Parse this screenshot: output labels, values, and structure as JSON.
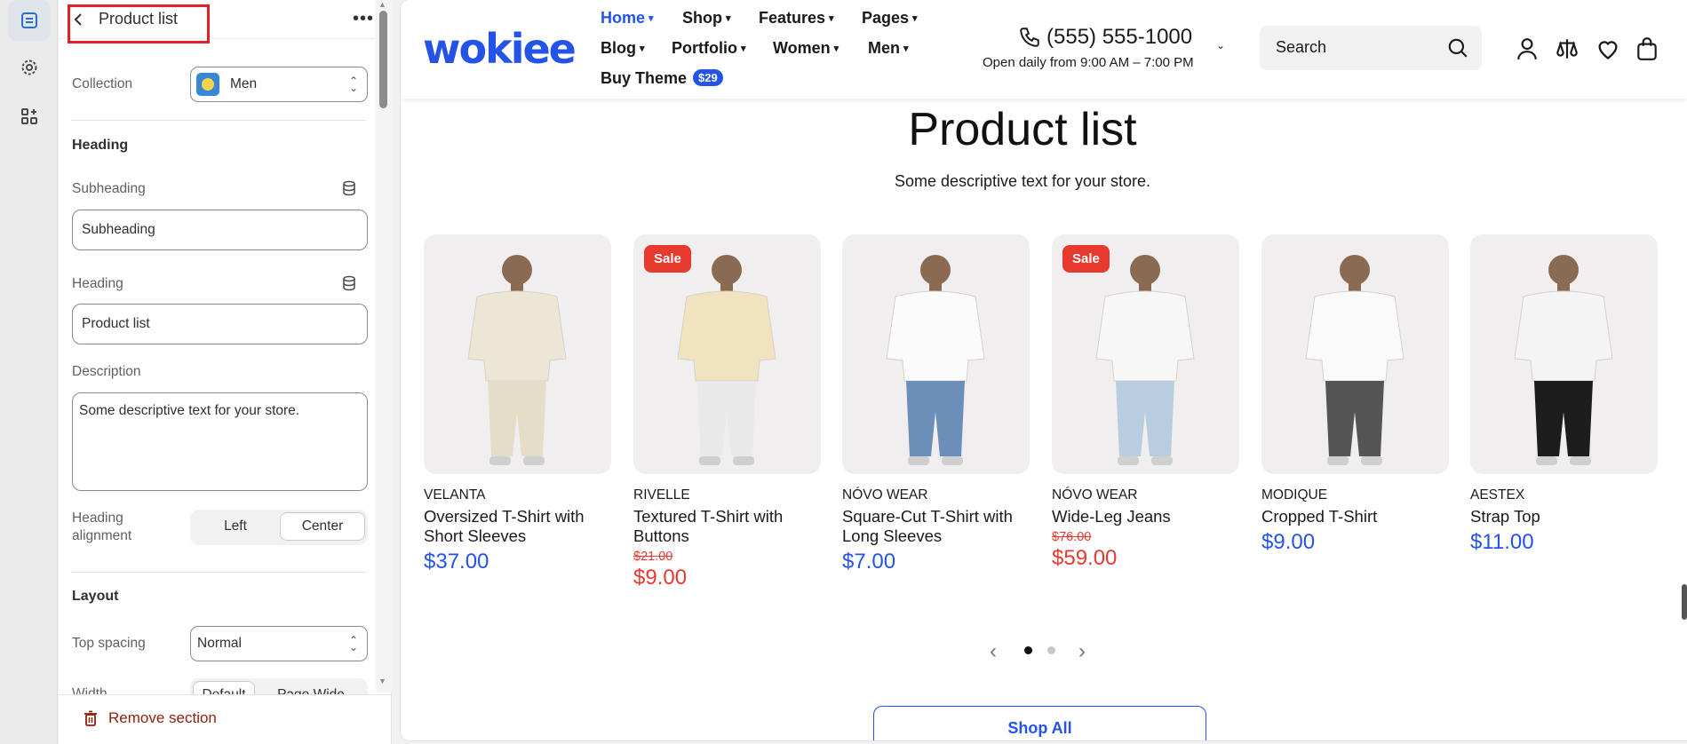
{
  "rail": {
    "items": [
      {
        "name": "sections-icon",
        "active": true
      },
      {
        "name": "settings-icon",
        "active": false
      },
      {
        "name": "apps-icon",
        "active": false
      }
    ]
  },
  "panel": {
    "title": "Product list",
    "collection_label": "Collection",
    "collection_value": "Men",
    "heading_section": "Heading",
    "subheading_label": "Subheading",
    "subheading_value": "Subheading",
    "heading_label": "Heading",
    "heading_value": "Product list",
    "description_label": "Description",
    "description_value": "Some descriptive text for your store.",
    "alignment_label": "Heading alignment",
    "alignment_left": "Left",
    "alignment_center": "Center",
    "layout_section": "Layout",
    "top_spacing_label": "Top spacing",
    "top_spacing_value": "Normal",
    "width_label": "Width",
    "width_default": "Default",
    "width_wide": "Page  Wide",
    "remove_label": "Remove section",
    "highlight_color": "#e5202b"
  },
  "store": {
    "logo": "wokiee",
    "nav": {
      "home": "Home",
      "shop": "Shop",
      "features": "Features",
      "pages": "Pages",
      "blog": "Blog",
      "portfolio": "Portfolio",
      "women": "Women",
      "men": "Men",
      "buy_theme": "Buy Theme",
      "buy_theme_price": "$29"
    },
    "phone": "(555) 555-1000",
    "hours": "Open daily from 9:00 AM – 7:00 PM",
    "search_placeholder": "Search",
    "accent": "#2453e8",
    "sale_color": "#e8392f"
  },
  "section": {
    "title": "Product list",
    "description": "Some descriptive text for your store.",
    "products": [
      {
        "vendor": "VELANTA",
        "name": "Oversized T-Shirt with Short Sleeves",
        "price": "$37.00",
        "old_price": "",
        "sale": false,
        "shirt": "#ece6d6",
        "bottom": "#e6ddc9"
      },
      {
        "vendor": "RIVELLE",
        "name": "Textured T-Shirt with Buttons",
        "price": "$9.00",
        "old_price": "$21.00",
        "sale": true,
        "badge": "Sale",
        "shirt": "#f1e3bf",
        "bottom": "#e9e9e9"
      },
      {
        "vendor": "NÓVO WEAR",
        "name": "Square-Cut T-Shirt with Long Sleeves",
        "price": "$7.00",
        "old_price": "",
        "sale": false,
        "shirt": "#fbfbfb",
        "bottom": "#6b8fb8"
      },
      {
        "vendor": "NÓVO WEAR",
        "name": "Wide-Leg Jeans",
        "price": "$59.00",
        "old_price": "$76.00",
        "sale": true,
        "badge": "Sale",
        "shirt": "#f7f7f7",
        "bottom": "#b9cde0"
      },
      {
        "vendor": "MODIQUE",
        "name": "Cropped T-Shirt",
        "price": "$9.00",
        "old_price": "",
        "sale": false,
        "shirt": "#fafafa",
        "bottom": "#555555"
      },
      {
        "vendor": "AESTEX",
        "name": "Strap Top",
        "price": "$11.00",
        "old_price": "",
        "sale": false,
        "shirt": "#f4f4f4",
        "bottom": "#1d1d1d"
      }
    ],
    "carousel": {
      "pages": 2,
      "current": 1
    },
    "shop_all": "Shop All"
  }
}
